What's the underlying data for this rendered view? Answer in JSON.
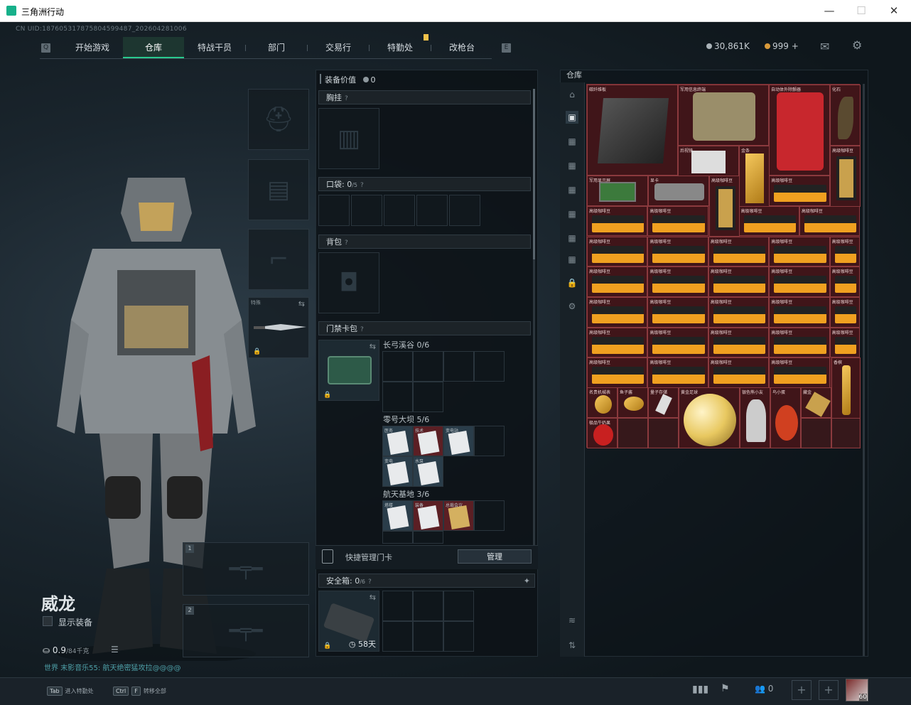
{
  "window": {
    "title": "三角洲行动",
    "minimize": "—",
    "maximize": "☐",
    "close": "✕"
  },
  "uid": "CN UID:1876053178758045994​87_202604281006",
  "nav": {
    "tabs": [
      "开始游戏",
      "仓库",
      "特战干员",
      "部门",
      "交易行",
      "特勤处",
      "改枪台"
    ],
    "active": "仓库"
  },
  "currency": {
    "coins": "30,861K",
    "tickets": "999",
    "plus": "+"
  },
  "character": {
    "name": "威龙",
    "show_equipment": "显示装备",
    "weight": "0.9",
    "weight_max": "/84千克",
    "chat": "世界 末影音乐55: 航天绝密猛攻拉@@@@"
  },
  "left_slots": {
    "melee_label": "特殊",
    "weapon1": "1",
    "weapon2": "2"
  },
  "middle": {
    "equip_value_label": "装备价值",
    "equip_value": "0",
    "chest_rig": "胸挂",
    "pocket": "口袋:",
    "pocket_count": "0",
    "pocket_max": "/5",
    "backpack": "背包",
    "keycard_bag": "门禁卡包",
    "key_sections": [
      {
        "name": "长弓溪谷",
        "count": "0/6"
      },
      {
        "name": "零号大坝",
        "count": "5/6",
        "cards": [
          "医务",
          "技术",
          "变电站",
          "变电",
          "水泵"
        ]
      },
      {
        "name": "航天基地",
        "count": "3/6",
        "cards": [
          "塔楼",
          "装备",
          "总裁会议"
        ]
      }
    ],
    "quick_manage": "快捷管理门卡",
    "manage_button": "管理",
    "safe_box": "安全箱:",
    "safe_count": "0",
    "safe_max": "/6",
    "safe_days": "58天"
  },
  "warehouse": {
    "title": "仓库",
    "items": [
      {
        "name": "碳纤维板",
        "color": "#3a3a3a"
      },
      {
        "name": "军用信息终端",
        "color": "#9a8e6a"
      },
      {
        "name": "自动体外除颤器",
        "color": "#c8272d"
      },
      {
        "name": "化石",
        "color": "#5a4a30"
      },
      {
        "name": "后视镜",
        "color": "#ddd"
      },
      {
        "name": "金条",
        "color": "#e0b040"
      },
      {
        "name": "高级咖啡豆",
        "color": "#c9a14d"
      },
      {
        "name": "军用显示屏",
        "color": "#3c7a3c"
      },
      {
        "name": "显卡",
        "color": "#888"
      },
      {
        "name": "高级咖啡豆",
        "color": "#c9a14d"
      },
      {
        "name": "名贵机械表",
        "color": "#e0b040"
      },
      {
        "name": "鱼子酱",
        "color": "#c9a14d"
      },
      {
        "name": "量子存储",
        "color": "#ddd"
      },
      {
        "name": "黄金足球",
        "color": "#e8c860"
      },
      {
        "name": "银色熊小友",
        "color": "#ccc"
      },
      {
        "name": "鸟小蛋",
        "color": "#d04020"
      },
      {
        "name": "藏金",
        "color": "#c9a14d"
      },
      {
        "name": "香槟",
        "color": "#c9a14d"
      },
      {
        "name": "极品牛奶果",
        "color": "#c82020"
      },
      {
        "name": "高级咖啡豆",
        "color": "#c9a14d"
      },
      {
        "name": "高级咖啡豆",
        "color": "#c9a14d"
      },
      {
        "name": "高级咖啡豆",
        "color": "#c9a14d"
      }
    ]
  },
  "bottom": {
    "tab_key": "Tab",
    "tab_text": "进入特勤处",
    "ctrl_key": "Ctrl",
    "f_key": "F",
    "ctrl_text": "转移全部",
    "friends": "0",
    "level": "60"
  }
}
